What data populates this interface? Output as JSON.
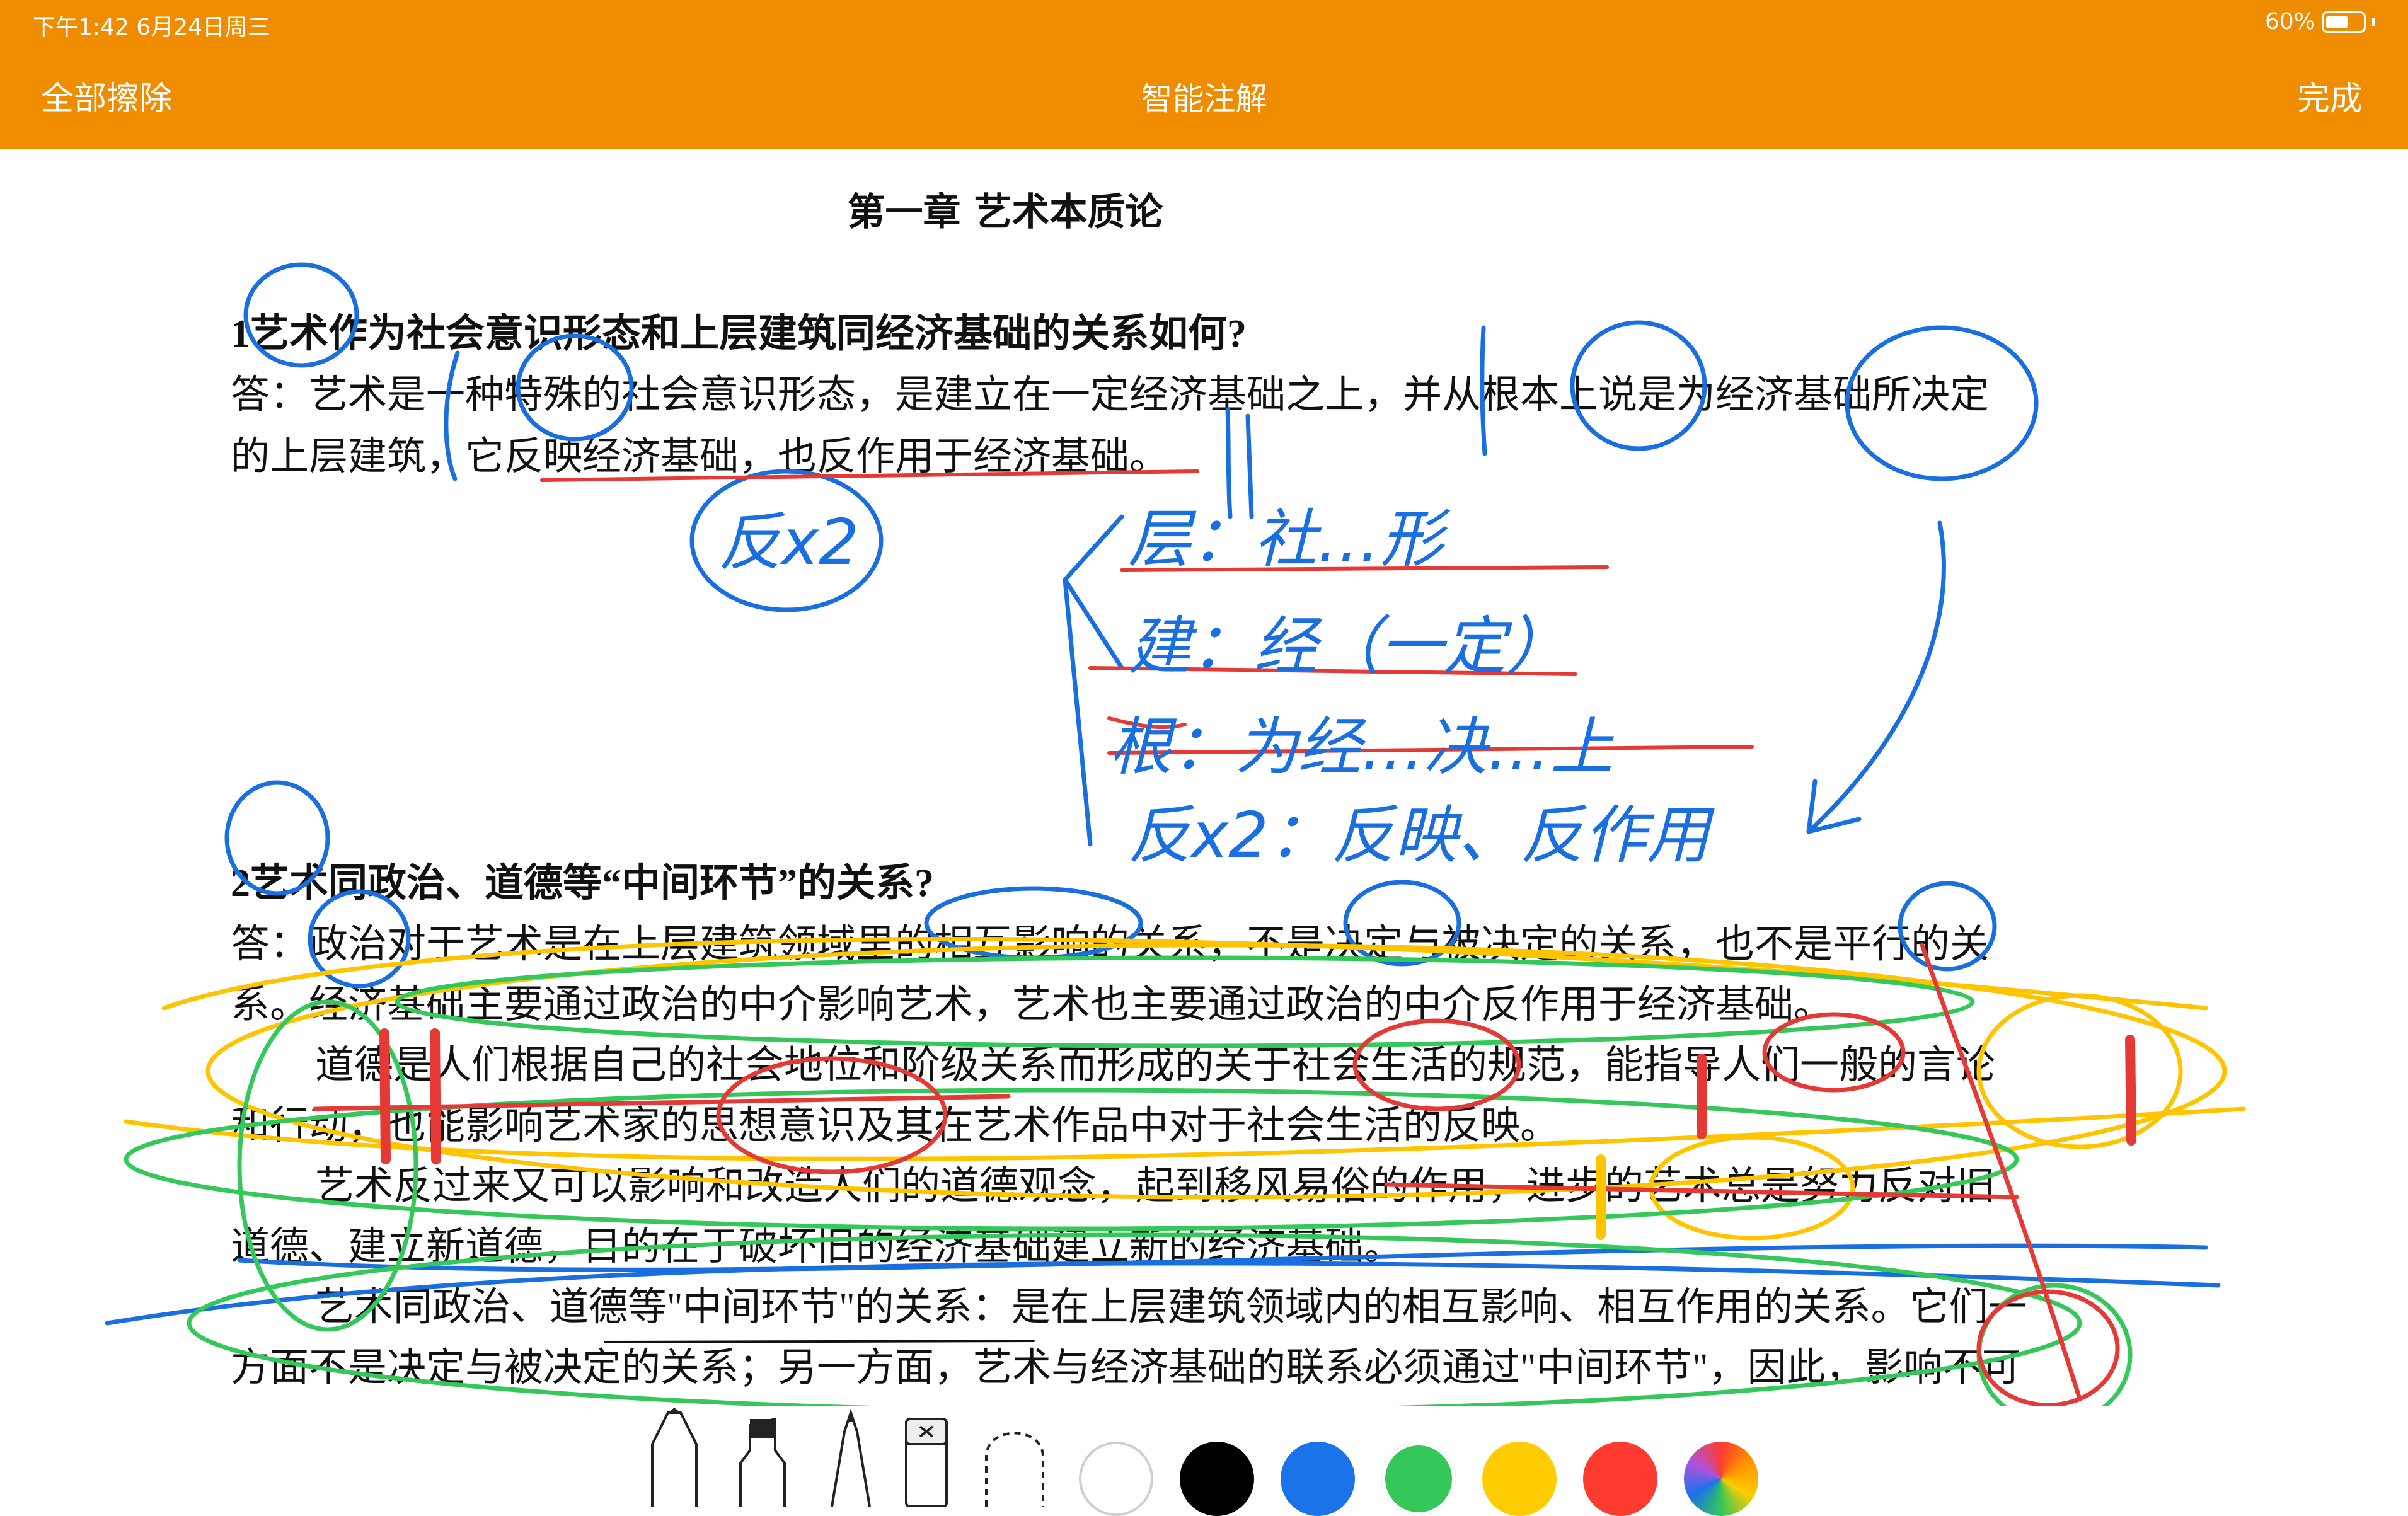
{
  "status_bar": {
    "time": "下午1:42   6月24日周三",
    "battery": "60%",
    "battery_level": 0.6
  },
  "nav": {
    "clear_label": "全部擦除",
    "title": "智能注解",
    "done_label": "完成"
  },
  "document": {
    "chapter_title": "第一章 艺术本质论",
    "q1": {
      "question": "1艺术作为社会意识形态和上层建筑同经济基础的关系如何?",
      "answer_line1": "答：艺术是一种特殊的社会意识形态，是建立在一定经济基础之上，并从根本上说是为经济基础所决定",
      "answer_line2": "的上层建筑，它反映经济基础，也反作用于经济基础。"
    },
    "q2": {
      "question": "2艺术同政治、道德等“中间环节”的关系?",
      "lines": [
        "答：政治对于艺术是在上层建筑领域里的相互影响的关系，不是决定与被决定的关系，也不是平行的关",
        "系。经济基础主要通过政治的中介影响艺术，艺术也主要通过政治的中介反作用于经济基础。",
        "道德是人们根据自己的社会地位和阶级关系而形成的关于社会生活的规范，能指导人们一般的言论",
        "和行动，也能影响艺术家的思想意识及其在艺术作品中对于社会生活的反映。",
        "艺术反过来又可以影响和改造人们的道德观念，起到移风易俗的作用，进步的艺术总是努力反对旧",
        "道德、建立新道德，目的在于破坏旧的经济基础建立新的经济基础。",
        "艺术同政治、道德等\"中间环节\"的关系：是在上层建筑领域内的相互影响、相互作用的关系。它们一",
        "方面不是决定与被决定的关系；另一方面，艺术与经济基础的联系必须通过\"中间环节\"，因此，影响不可"
      ]
    }
  },
  "handwriting": {
    "circle_note": "反x2",
    "notes": [
      "层：社…形",
      "建：经（一定）",
      "根：为经…决…上",
      "反x2：反映、反作用"
    ]
  },
  "toolbar": {
    "tools": [
      "pen-icon",
      "marker-icon",
      "pencil-icon",
      "eraser-icon",
      "lasso-icon"
    ],
    "colors": [
      "#ffffff",
      "#000000",
      "#1a73e8",
      "#34c759",
      "#ffcc00",
      "#ff3b30",
      "multicolor"
    ],
    "selected_color": "#34c759"
  }
}
